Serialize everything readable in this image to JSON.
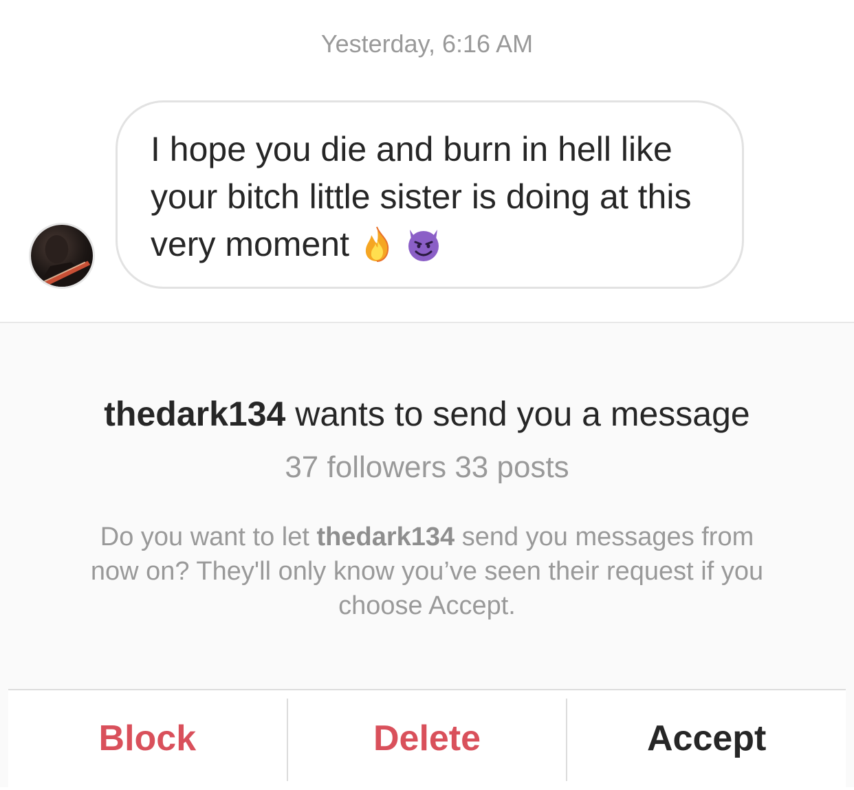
{
  "thread": {
    "timestamp": "Yesterday, 6:16 AM",
    "message": {
      "text": "I hope you die and burn in hell like your bitch little sister is doing at this very moment",
      "emojis": [
        "fire-emoji",
        "smiling-devil-emoji"
      ]
    },
    "sender_avatar": "avatar-icon"
  },
  "request": {
    "username": "thedark134",
    "title_suffix": " wants to send you a message",
    "stats": "37 followers 33 posts",
    "desc_prefix": "Do you want to let ",
    "desc_username": "thedark134",
    "desc_suffix": " send you messages from now on? They'll only know you’ve seen their request if you choose Accept."
  },
  "actions": {
    "block_label": "Block",
    "delete_label": "Delete",
    "accept_label": "Accept"
  },
  "colors": {
    "danger": "#d9505b",
    "text_primary": "#262626",
    "text_secondary": "#999999",
    "panel_bg": "#fafafa"
  }
}
